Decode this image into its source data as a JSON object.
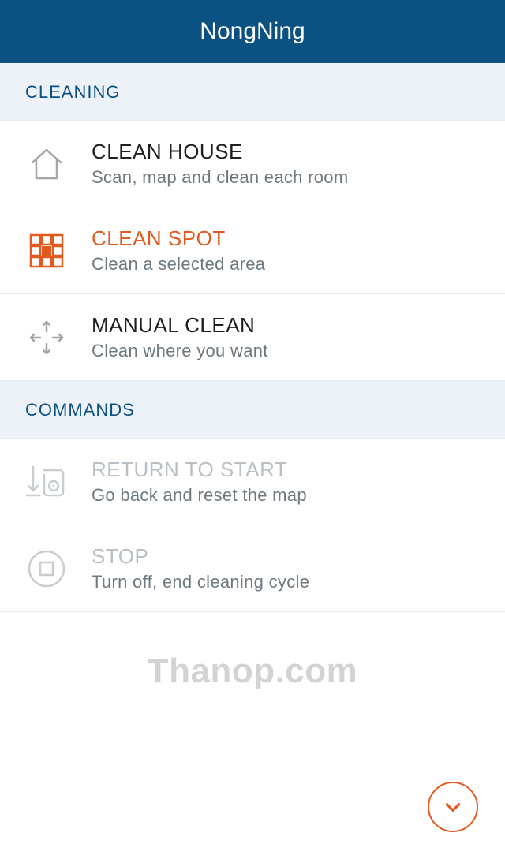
{
  "header": {
    "title": "NongNing"
  },
  "sections": {
    "cleaning": {
      "label": "CLEANING"
    },
    "commands": {
      "label": "COMMANDS"
    }
  },
  "items": {
    "clean_house": {
      "title": "CLEAN HOUSE",
      "subtitle": "Scan, map and clean each room"
    },
    "clean_spot": {
      "title": "CLEAN SPOT",
      "subtitle": "Clean a selected area"
    },
    "manual_clean": {
      "title": "MANUAL CLEAN",
      "subtitle": "Clean where you want"
    },
    "return_to_start": {
      "title": "RETURN TO START",
      "subtitle": "Go back and reset the map"
    },
    "stop": {
      "title": "STOP",
      "subtitle": "Turn off, end cleaning cycle"
    }
  },
  "colors": {
    "header_bg": "#0b5182",
    "accent": "#e35a1f",
    "section_bg": "#edf2f8",
    "muted": "#6e7880",
    "disabled": "#b8bfc5"
  },
  "watermark": "Thanop.com"
}
